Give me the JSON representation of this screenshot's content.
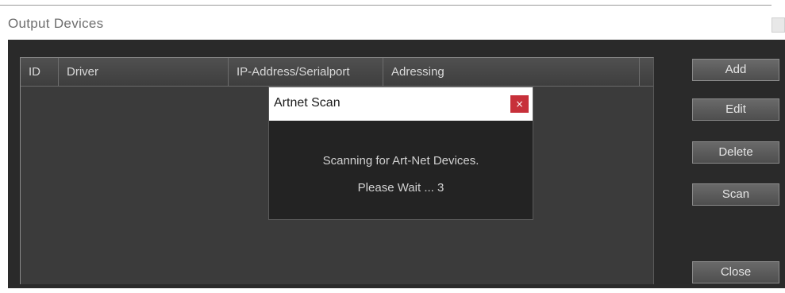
{
  "window": {
    "title": "Output Devices"
  },
  "table": {
    "columns": [
      "ID",
      "Driver",
      "IP-Address/Serialport",
      "Adressing"
    ],
    "rows": []
  },
  "buttons": {
    "add": "Add",
    "edit": "Edit",
    "delete": "Delete",
    "scan": "Scan",
    "close": "Close"
  },
  "dialog": {
    "title": "Artnet Scan",
    "close_glyph": "×",
    "message": "Scanning for Art-Net Devices.",
    "countdown": "Please Wait ... 3"
  },
  "colors": {
    "background": "#2a2a2a",
    "table_bg": "#3b3b3b",
    "dialog_close": "#c7303a"
  }
}
